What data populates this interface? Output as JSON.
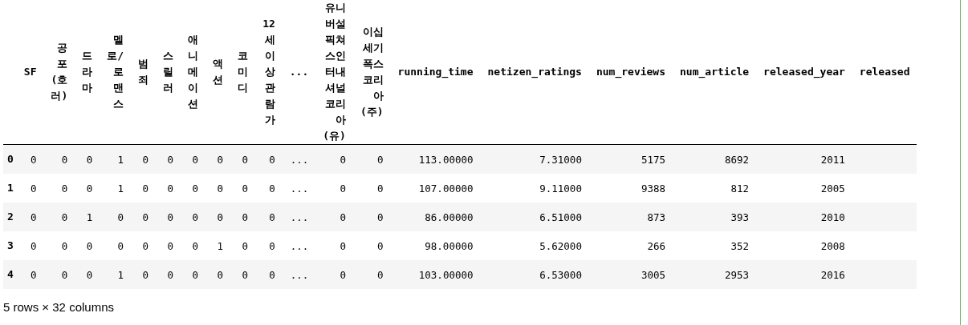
{
  "table": {
    "columns": [
      "SF",
      "공포(호러)",
      "드라마",
      "멜로/로맨스",
      "범죄",
      "스릴러",
      "애니메이션",
      "액션",
      "코미디",
      "12세이상관람가",
      "...",
      "유니버설픽쳐스인터내셔널코리아(유)",
      "이십세기폭스코리아(주)",
      "running_time",
      "netizen_ratings",
      "num_reviews",
      "num_article",
      "released_year",
      "released"
    ],
    "rows": [
      {
        "index": "0",
        "cells": [
          "0",
          "0",
          "0",
          "1",
          "0",
          "0",
          "0",
          "0",
          "0",
          "0",
          "...",
          "0",
          "0",
          "113.00000",
          "7.31000",
          "5175",
          "8692",
          "2011"
        ]
      },
      {
        "index": "1",
        "cells": [
          "0",
          "0",
          "0",
          "1",
          "0",
          "0",
          "0",
          "0",
          "0",
          "0",
          "...",
          "0",
          "0",
          "107.00000",
          "9.11000",
          "9388",
          "812",
          "2005"
        ]
      },
      {
        "index": "2",
        "cells": [
          "0",
          "0",
          "1",
          "0",
          "0",
          "0",
          "0",
          "0",
          "0",
          "0",
          "...",
          "0",
          "0",
          "86.00000",
          "6.51000",
          "873",
          "393",
          "2010"
        ]
      },
      {
        "index": "3",
        "cells": [
          "0",
          "0",
          "0",
          "0",
          "0",
          "0",
          "0",
          "1",
          "0",
          "0",
          "...",
          "0",
          "0",
          "98.00000",
          "5.62000",
          "266",
          "352",
          "2008"
        ]
      },
      {
        "index": "4",
        "cells": [
          "0",
          "0",
          "0",
          "1",
          "0",
          "0",
          "0",
          "0",
          "0",
          "0",
          "...",
          "0",
          "0",
          "103.00000",
          "6.53000",
          "3005",
          "2953",
          "2016"
        ]
      }
    ]
  },
  "footer": "5 rows × 32 columns"
}
